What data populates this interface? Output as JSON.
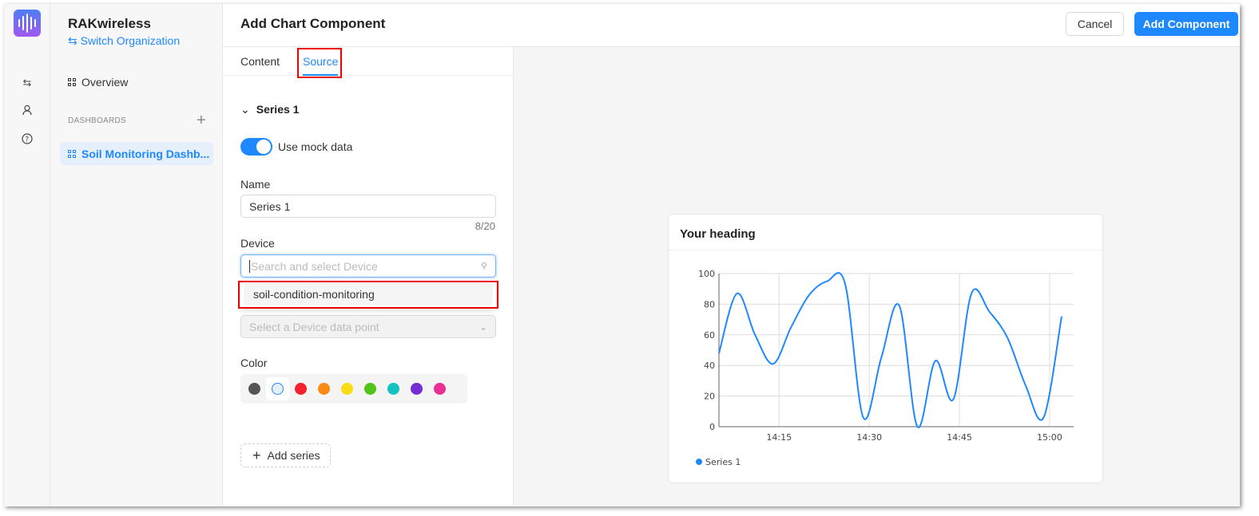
{
  "org": {
    "name": "RAKwireless",
    "switch_label": "Switch Organization"
  },
  "rail": {
    "icons": [
      "swap-icon",
      "user-icon",
      "help-icon"
    ]
  },
  "sidebar": {
    "overview": "Overview",
    "dashboards_heading": "DASHBOARDS",
    "dashboards": [
      {
        "label": "Soil Monitoring Dashb...",
        "active": true
      }
    ]
  },
  "header": {
    "title": "Add Chart Component",
    "cancel": "Cancel",
    "add": "Add Component"
  },
  "tabs": [
    {
      "label": "Content"
    },
    {
      "label": "Source",
      "active": true
    }
  ],
  "form": {
    "series_title": "Series 1",
    "mock_label": "Use mock data",
    "mock_on": true,
    "name_label": "Name",
    "name_value": "Series 1",
    "name_count": "8/20",
    "device_label": "Device",
    "device_placeholder": "Search and select Device",
    "device_option": "soil-condition-monitoring",
    "datapoint_placeholder": "Select a Device data point",
    "color_label": "Color",
    "colors": [
      "#555555",
      "#1e88ff",
      "#f5222d",
      "#fa8c16",
      "#fadb14",
      "#52c41a",
      "#13c2c2",
      "#722ed1",
      "#eb2f96"
    ],
    "selected_color": "#1e88ff",
    "add_series": "Add series"
  },
  "card": {
    "heading": "Your heading"
  },
  "chart_data": {
    "type": "line",
    "x": [
      "14:05",
      "14:08",
      "14:11",
      "14:14",
      "14:17",
      "14:20",
      "14:23",
      "14:26",
      "14:29",
      "14:32",
      "14:35",
      "14:38",
      "14:41",
      "14:44",
      "14:47",
      "14:50",
      "14:53",
      "14:56",
      "14:59",
      "15:02"
    ],
    "series": [
      {
        "name": "Series 1",
        "color": "#1e88ff",
        "values": [
          48,
          87,
          60,
          41,
          65,
          86,
          95,
          93,
          6,
          45,
          79,
          0,
          43,
          18,
          87,
          75,
          58,
          27,
          6,
          72
        ]
      }
    ],
    "xticks": [
      "14:15",
      "14:30",
      "14:45",
      "15:00"
    ],
    "yticks": [
      0,
      20,
      40,
      60,
      80,
      100
    ],
    "xlim": [
      "14:05",
      "15:04"
    ],
    "ylim": [
      0,
      100
    ],
    "grid": true,
    "legend": "bottom-left"
  }
}
